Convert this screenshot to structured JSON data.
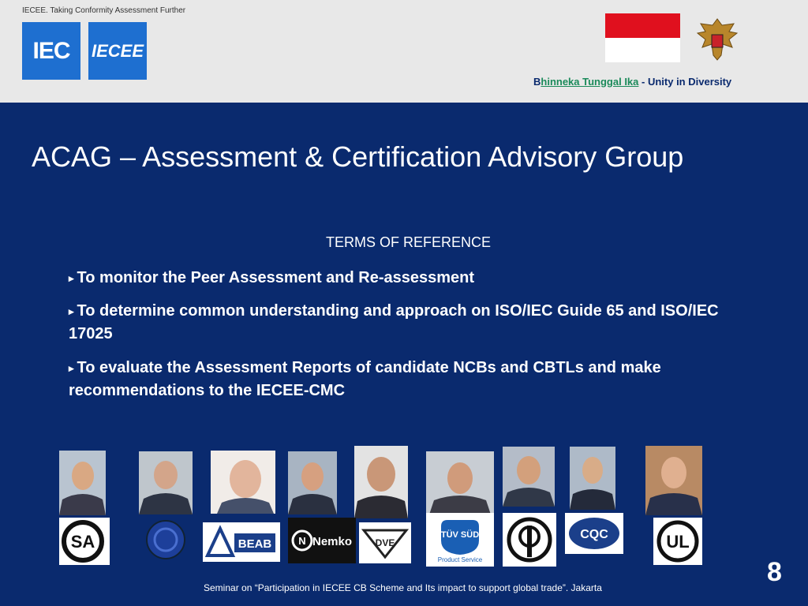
{
  "header": {
    "tagline": "IECEE. Taking Conformity Assessment Further",
    "logo_iec": "IEC",
    "logo_iecee": "IECEE",
    "motto_prefix": "B",
    "motto_link": "hinneka Tunggal Ika",
    "motto_suffix": " - Unity in Diversity"
  },
  "slide": {
    "title": "ACAG – Assessment & Certification Advisory Group",
    "section": "TERMS OF REFERENCE",
    "bullets": [
      "To monitor the Peer Assessment and Re-assessment",
      "To determine common understanding and approach on ISO/IEC Guide 65 and ISO/IEC 17025",
      "To evaluate the Assessment Reports of candidate NCBs and CBTLs and make recommendations to the IECEE-CMC"
    ]
  },
  "logos": [
    "SA",
    "",
    "BEAB",
    "Nemko",
    "DVE",
    "TÜV SÜD",
    "",
    "CQC",
    "UL"
  ],
  "logo_caption": "Product Service",
  "footer": "Seminar on “Participation in IECEE CB Scheme and Its impact to support global trade”. Jakarta",
  "page_number": "8",
  "colors": {
    "slide_bg": "#0a2a6e",
    "header_bg": "#e8e8e8",
    "iec_blue": "#1e6fd0",
    "flag_red": "#e0101e"
  },
  "icons": [
    "iec-logo",
    "iecee-logo",
    "indonesia-flag",
    "garuda-emblem",
    "bullet-triangle"
  ]
}
